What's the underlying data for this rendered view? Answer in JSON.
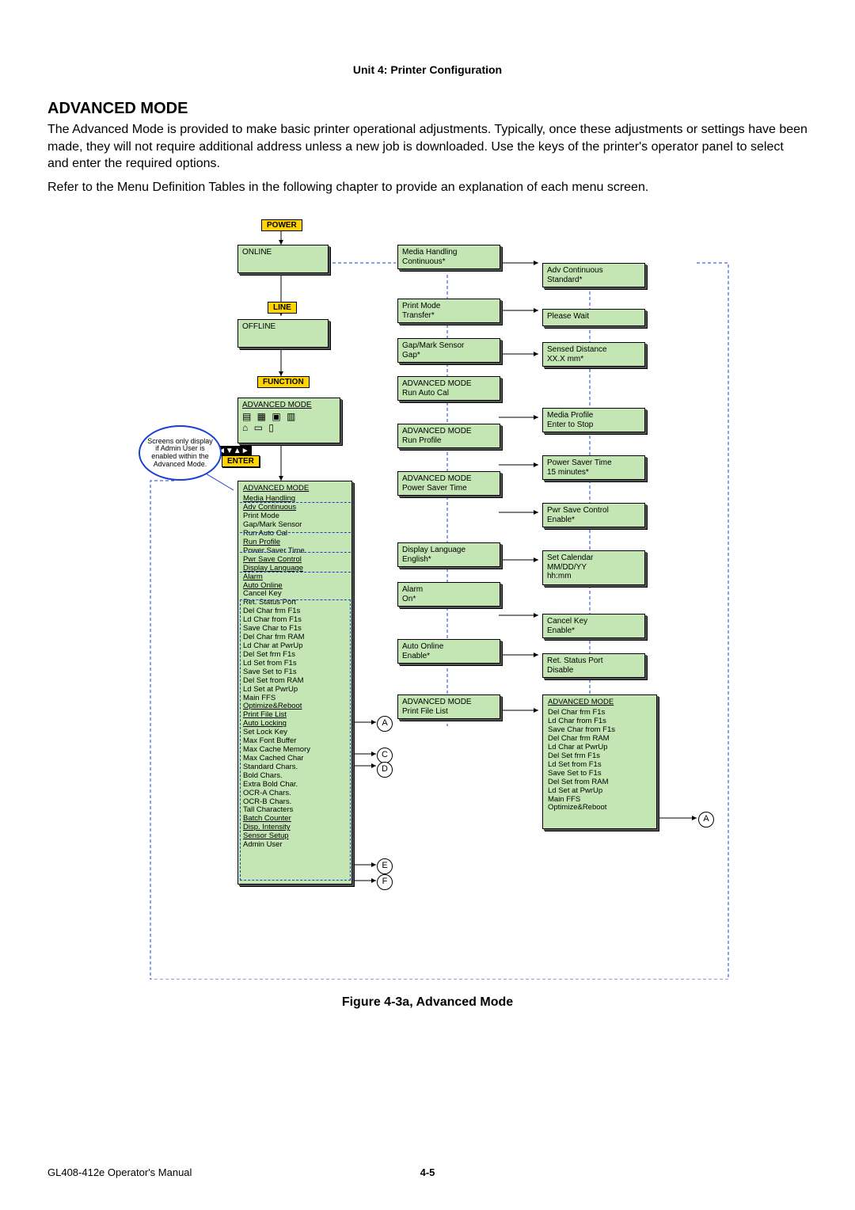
{
  "header": {
    "unit": "Unit 4:  Printer Configuration"
  },
  "section": {
    "title": "ADVANCED MODE",
    "p1": "The Advanced Mode is provided to make basic printer operational adjustments. Typically, once these adjustments or settings have been made, they will not require additional address unless a new job is downloaded. Use the keys of the printer's operator panel to select and enter the required options.",
    "p2": "Refer to the Menu Definition Tables in the following chapter to provide an explanation of each menu screen."
  },
  "labels": {
    "power": "POWER",
    "line": "LINE",
    "function": "FUNCTION",
    "enter": "ENTER",
    "online": "ONLINE",
    "offline": "OFFLINE",
    "note_oval": "Screens only display if Admin User is enabled within the Advanced Mode."
  },
  "boxes": {
    "media_handling": {
      "l1": "Media Handling",
      "l2": "Continuous*"
    },
    "adv_continuous": {
      "l1": "Adv Continuous",
      "l2": "Standard*"
    },
    "print_mode": {
      "l1": "Print Mode",
      "l2": "Transfer*"
    },
    "please_wait": {
      "l1": "Please Wait",
      "l2": ""
    },
    "gap_mark": {
      "l1": "Gap/Mark Sensor",
      "l2": "Gap*"
    },
    "sensed": {
      "l1": "Sensed Distance",
      "l2": "XX.X  mm*"
    },
    "run_auto_cal": {
      "l1": "ADVANCED MODE",
      "l2": "Run Auto Cal"
    },
    "media_profile": {
      "l1": "Media Profile",
      "l2": "Enter to Stop"
    },
    "run_profile": {
      "l1": "ADVANCED MODE",
      "l2": "Run Profile"
    },
    "power_saver_time_r": {
      "l1": "Power Saver Time",
      "l2": "15 minutes*"
    },
    "power_saver_adv": {
      "l1": "ADVANCED MODE",
      "l2": "Power Saver Time"
    },
    "pwr_save_ctrl": {
      "l1": "Pwr Save Control",
      "l2": "Enable*"
    },
    "display_lang": {
      "l1": "Display Language",
      "l2": "English*"
    },
    "set_calendar": {
      "l1": "Set Calendar",
      "l2": "MM/DD/YY",
      "l3": "hh:mm"
    },
    "alarm": {
      "l1": "Alarm",
      "l2": "On*"
    },
    "cancel_key": {
      "l1": "Cancel Key",
      "l2": "Enable*"
    },
    "auto_online": {
      "l1": "Auto Online",
      "l2": "Enable*"
    },
    "ret_status": {
      "l1": "Ret. Status Port",
      "l2": "Disable"
    },
    "print_file_list": {
      "l1": "ADVANCED MODE",
      "l2": "Print File List"
    },
    "advanced_mode_icons": "ADVANCED MODE"
  },
  "tall_left": {
    "header": "ADVANCED MODE",
    "items": [
      {
        "t": "Media Handling",
        "u": true
      },
      {
        "t": "Adv Continuous",
        "u": true
      },
      {
        "t": "Print Mode",
        "u": false
      },
      {
        "t": "Gap/Mark Sensor",
        "u": false
      },
      {
        "t": "Run Auto Cal",
        "u": false
      },
      {
        "t": "Run Profile",
        "u": true
      },
      {
        "t": "Power Saver Time",
        "u": false
      },
      {
        "t": "Pwr Save Control",
        "u": true
      },
      {
        "t": "Display Language",
        "u": true
      },
      {
        "t": "Alarm",
        "u": true
      },
      {
        "t": "Auto Online",
        "u": true
      },
      {
        "t": "Cancel Key",
        "u": false
      },
      {
        "t": "Ret. Status Port",
        "u": false
      },
      {
        "t": "Del Char frm F1s",
        "u": false
      },
      {
        "t": "Ld Char from F1s",
        "u": false
      },
      {
        "t": "Save Char to F1s",
        "u": false
      },
      {
        "t": "Del Char frm RAM",
        "u": false
      },
      {
        "t": "Ld Char at PwrUp",
        "u": false
      },
      {
        "t": "Del Set frm F1s",
        "u": false
      },
      {
        "t": "Ld Set from F1s",
        "u": false
      },
      {
        "t": "Save Set to F1s",
        "u": false
      },
      {
        "t": "Del Set from RAM",
        "u": false
      },
      {
        "t": "Ld Set at PwrUp",
        "u": false
      },
      {
        "t": "Main FFS",
        "u": false
      },
      {
        "t": "Optimize&Reboot",
        "u": true
      },
      {
        "t": "Print File List",
        "u": true
      },
      {
        "t": "Auto Locking",
        "u": true
      },
      {
        "t": "Set Lock Key",
        "u": false
      },
      {
        "t": "Max Font Buffer",
        "u": false
      },
      {
        "t": "Max Cache Memory",
        "u": false
      },
      {
        "t": "Max Cached Char",
        "u": false
      },
      {
        "t": "Standard Chars.",
        "u": false
      },
      {
        "t": "Bold Chars.",
        "u": false
      },
      {
        "t": "Extra Bold Char.",
        "u": false
      },
      {
        "t": "OCR-A Chars.",
        "u": false
      },
      {
        "t": "OCR-B Chars.",
        "u": false
      },
      {
        "t": "Tall Characters",
        "u": false
      },
      {
        "t": "Batch Counter",
        "u": true
      },
      {
        "t": "Disp. Intensity",
        "u": true
      },
      {
        "t": "Sensor Setup",
        "u": true
      },
      {
        "t": "Admin User",
        "u": false
      }
    ]
  },
  "tall_right": {
    "header": "ADVANCED MODE",
    "items": [
      "Del Char frm F1s",
      "Ld Char from F1s",
      "Save Char from F1s",
      "Del Char frm RAM",
      "Ld Char at PwrUp",
      "Del Set frm F1s",
      "Ld Set from F1s",
      "Save Set to F1s",
      "Del Set from RAM",
      "Ld Set at PwrUp",
      "Main FFS",
      "Optimize&Reboot"
    ]
  },
  "circles": {
    "a": "A",
    "c": "C",
    "d": "D",
    "e": "E",
    "f": "F"
  },
  "figure_caption": "Figure 4-3a, Advanced Mode",
  "footer": {
    "left": "GL408-412e Operator's Manual",
    "center": "4-5"
  }
}
